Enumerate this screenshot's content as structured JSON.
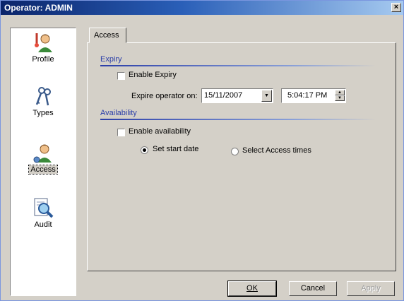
{
  "window": {
    "title": "Operator: ADMIN",
    "close_glyph": "×"
  },
  "sidebar": {
    "items": [
      {
        "label": "Profile",
        "icon": "user-profile-icon"
      },
      {
        "label": "Types",
        "icon": "keys-icon"
      },
      {
        "label": "Access",
        "icon": "user-access-icon",
        "selected": true
      },
      {
        "label": "Audit",
        "icon": "audit-magnifier-icon"
      }
    ]
  },
  "tabs": [
    {
      "label": "Access"
    }
  ],
  "expiry": {
    "section_title": "Expiry",
    "enable_label": "Enable Expiry",
    "enable_checked": false,
    "expire_label": "Expire operator on:",
    "date_value": "15/11/2007",
    "time_value": "5:04:17 PM"
  },
  "availability": {
    "section_title": "Availability",
    "enable_label": "Enable availability",
    "enable_checked": false,
    "radio_start_label": "Set start date",
    "radio_access_label": "Select Access times",
    "selected": "start"
  },
  "buttons": {
    "ok": "OK",
    "cancel": "Cancel",
    "apply": "Apply"
  },
  "colors": {
    "accent": "#2b3ea8",
    "title_bar": "#0a246a",
    "face": "#d4d0c8"
  }
}
